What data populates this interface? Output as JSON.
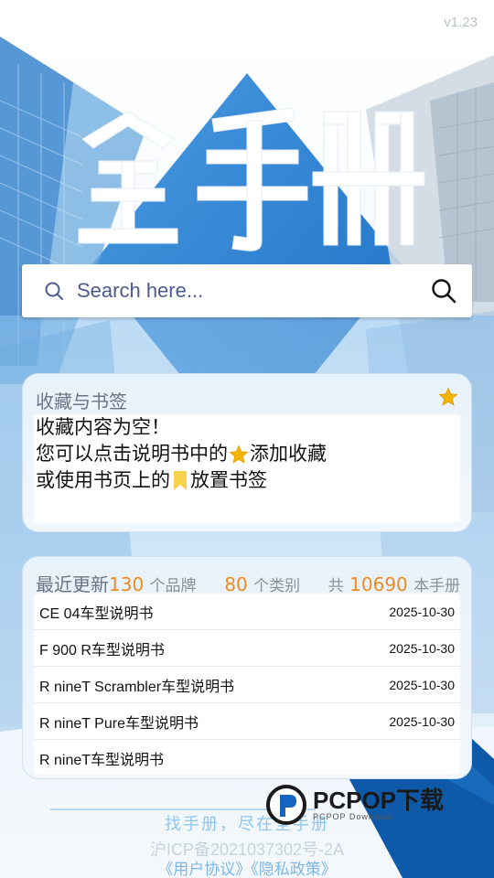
{
  "app": {
    "version": "v1.23",
    "hero_title": "全手册"
  },
  "search": {
    "placeholder": "Search here..."
  },
  "favorites": {
    "title": "收藏与书签",
    "line1": "收藏内容为空！",
    "line2_before": "您可以点击说明书中的",
    "line2_after": "添加收藏",
    "line3_before": "或使用书页上的",
    "line3_after": "放置书签"
  },
  "updates": {
    "title": "最近更新",
    "brand_count": "130",
    "brand_unit": "个品牌",
    "category_count": "80",
    "category_unit": "个类别",
    "total_prefix": "共",
    "manual_count": "10690",
    "manual_unit": "本手册",
    "items": [
      {
        "name": "CE 04车型说明书",
        "date": "2025-10-30"
      },
      {
        "name": "F 900 R车型说明书",
        "date": "2025-10-30"
      },
      {
        "name": "R nineT Scrambler车型说明书",
        "date": "2025-10-30"
      },
      {
        "name": "R nineT Pure车型说明书",
        "date": "2025-10-30"
      },
      {
        "name": "R nineT车型说明书",
        "date": ""
      }
    ]
  },
  "footer": {
    "slogan": "找手册，尽在全手册",
    "icp": "沪ICP备2021037302号-2A",
    "user_agreement": "《用户协议》",
    "privacy_policy": "《隐私政策》"
  },
  "watermark": {
    "main": "PCPOP下载",
    "sub": "PCPOP Download"
  },
  "colors": {
    "accent_orange": "#f08a1c",
    "brand_blue": "#1565c0",
    "link_blue": "#7fb7e6",
    "star": "#f5b400",
    "bookmark": "#f7d24a"
  },
  "icons": {
    "search_lead": "search-icon",
    "search_button": "search-icon",
    "favorite_star": "star-icon",
    "bookmark": "bookmark-icon"
  }
}
